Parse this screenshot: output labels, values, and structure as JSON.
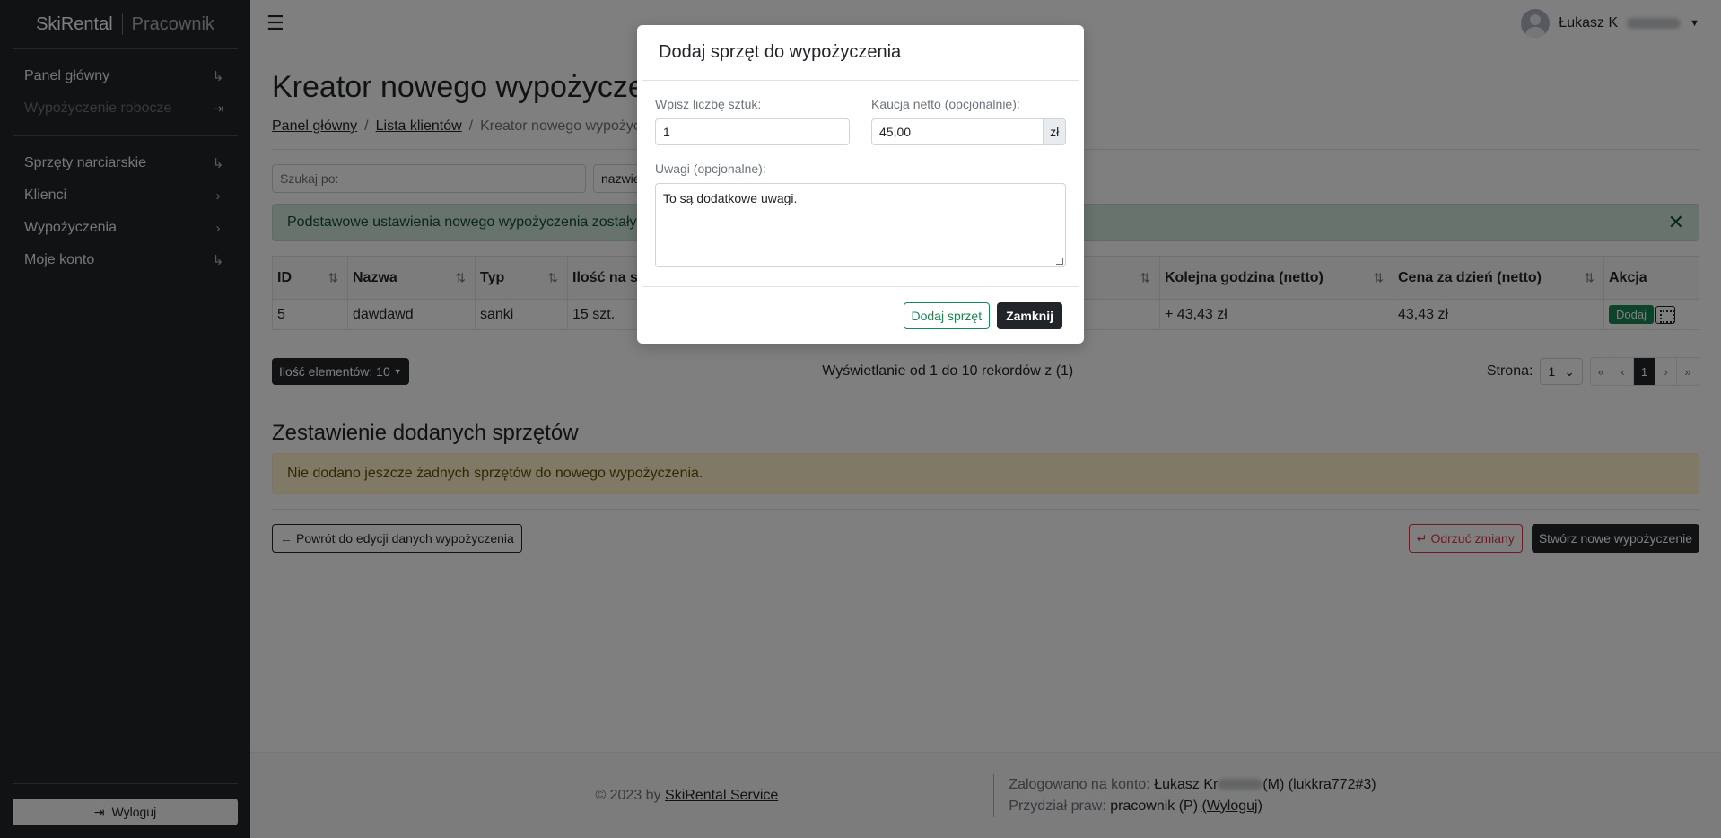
{
  "brand": {
    "name": "SkiRental",
    "role": "Pracownik"
  },
  "sidebar": {
    "group1": [
      {
        "label": "Panel główny",
        "icon": "arrow-turn-right-icon",
        "glyph": "↳",
        "disabled": false
      },
      {
        "label": "Wypożyczenie robocze",
        "icon": "arrow-bar-right-icon",
        "glyph": "⇥",
        "disabled": true
      }
    ],
    "group2": [
      {
        "label": "Sprzęty narciarskie",
        "icon": "arrow-turn-right-icon",
        "glyph": "↳"
      },
      {
        "label": "Klienci",
        "icon": "chevron-right-icon",
        "glyph": "›"
      },
      {
        "label": "Wypożyczenia",
        "icon": "chevron-right-icon",
        "glyph": "›"
      },
      {
        "label": "Moje konto",
        "icon": "arrow-turn-right-icon",
        "glyph": "↳"
      }
    ],
    "logout_label": "Wyloguj"
  },
  "topbar": {
    "user_name": "Łukasz K"
  },
  "page": {
    "title": "Kreator nowego wypożyczenia",
    "breadcrumb": [
      "Panel główny",
      "Lista klientów",
      "Kreator nowego wypożyczenia"
    ],
    "search_placeholder": "Szukaj po:",
    "search_by": "nazwie",
    "alert_success": "Podstawowe ustawienia nowego wypożyczenia zostały zapisane."
  },
  "table": {
    "headers": [
      "ID",
      "Nazwa",
      "Typ",
      "Ilość na stanie",
      "",
      "Kolejna godzina (netto)",
      "Cena za dzień (netto)",
      "Akcja"
    ],
    "rows": [
      {
        "id": "5",
        "name": "dawdawd",
        "type": "sanki",
        "qty": "15 szt.",
        "next_hour": "+ 43,43 zł",
        "per_day": "43,43 zł",
        "action": "Dodaj"
      }
    ]
  },
  "pager": {
    "items_label": "Ilość elementów: 10",
    "info": "Wyświetlanie od 1 do 10 rekordów z (1)",
    "page_label": "Strona:",
    "page_value": "1",
    "current_page": "1"
  },
  "summary": {
    "title": "Zestawienie dodanych sprzętów",
    "empty_msg": "Nie dodano jeszcze żadnych sprzętów do nowego wypożyczenia."
  },
  "actions": {
    "back": "Powrót do edycji danych wypożyczenia",
    "discard": "Odrzuć zmiany",
    "create": "Stwórz nowe wypożyczenie"
  },
  "footer": {
    "copyright_prefix": "© 2023 by",
    "copyright_link": "SkiRental Service",
    "logged_prefix": "Zalogowano na konto:",
    "logged_name": "Łukasz Kr",
    "logged_suffix": "(M) (lukkra772#3)",
    "rights_prefix": "Przydział praw:",
    "rights_value": "pracownik (P)",
    "rights_logout": "(Wyloguj)"
  },
  "modal": {
    "title": "Dodaj sprzęt do wypożyczenia",
    "qty_label": "Wpisz liczbę sztuk:",
    "qty_value": "1",
    "deposit_label": "Kaucja netto (opcjonalnie):",
    "deposit_value": "45,00",
    "currency": "zł",
    "notes_label": "Uwagi (opcjonalne):",
    "notes_value": "To są dodatkowe uwagi.",
    "add_button": "Dodaj sprzęt",
    "close_button": "Zamknij"
  }
}
